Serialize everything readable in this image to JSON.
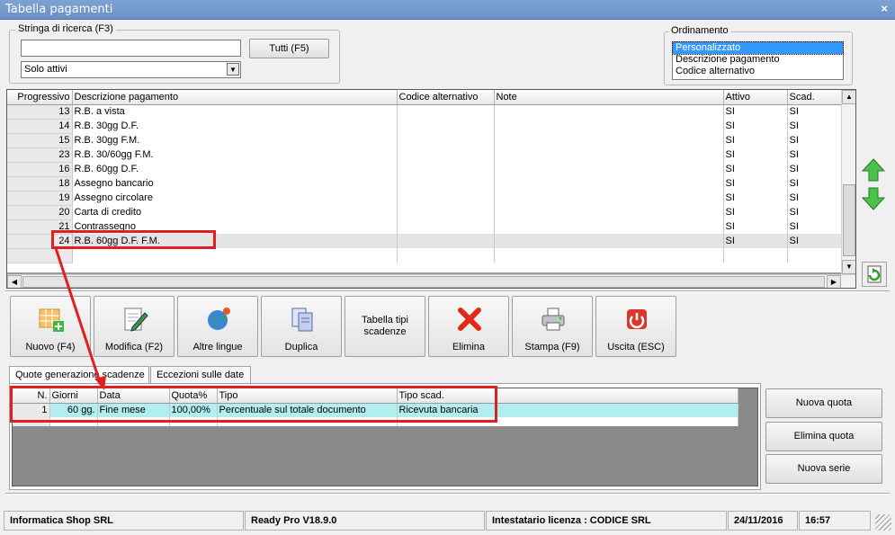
{
  "window": {
    "title": "Tabella pagamenti",
    "close": "×"
  },
  "search": {
    "legend": "Stringa di ricerca (F3)",
    "value": "",
    "all_button": "Tutti (F5)",
    "filter_selected": "Solo attivi"
  },
  "sort": {
    "legend": "Ordinamento",
    "options": [
      "Personalizzato",
      "Descrizione pagamento",
      "Codice alternativo"
    ],
    "selected": "Personalizzato"
  },
  "main_table": {
    "columns": [
      "Progressivo",
      "Descrizione pagamento",
      "Codice alternativo",
      "Note",
      "Attivo",
      "Scad."
    ],
    "rows": [
      {
        "prog": "13",
        "desc": "R.B. a vista",
        "code": "",
        "note": "",
        "active": "SI",
        "scad": "SI"
      },
      {
        "prog": "14",
        "desc": "R.B. 30gg D.F.",
        "code": "",
        "note": "",
        "active": "SI",
        "scad": "SI"
      },
      {
        "prog": "15",
        "desc": "R.B. 30gg F.M.",
        "code": "",
        "note": "",
        "active": "SI",
        "scad": "SI"
      },
      {
        "prog": "23",
        "desc": "R.B. 30/60gg F.M.",
        "code": "",
        "note": "",
        "active": "SI",
        "scad": "SI"
      },
      {
        "prog": "16",
        "desc": "R.B. 60gg D.F.",
        "code": "",
        "note": "",
        "active": "SI",
        "scad": "SI"
      },
      {
        "prog": "18",
        "desc": "Assegno bancario",
        "code": "",
        "note": "",
        "active": "SI",
        "scad": "SI"
      },
      {
        "prog": "19",
        "desc": "Assegno circolare",
        "code": "",
        "note": "",
        "active": "SI",
        "scad": "SI"
      },
      {
        "prog": "20",
        "desc": "Carta di credito",
        "code": "",
        "note": "",
        "active": "SI",
        "scad": "SI"
      },
      {
        "prog": "21",
        "desc": "Contrassegno",
        "code": "",
        "note": "",
        "active": "SI",
        "scad": "SI"
      },
      {
        "prog": "24",
        "desc": "R.B. 60gg D.F. F.M.",
        "code": "",
        "note": "",
        "active": "SI",
        "scad": "SI"
      }
    ]
  },
  "toolbar": {
    "new": "Nuovo (F4)",
    "edit": "Modifica (F2)",
    "languages": "Altre lingue",
    "duplicate": "Duplica",
    "due_types": "Tabella tipi scadenze",
    "delete": "Elimina",
    "print": "Stampa (F9)",
    "exit": "Uscita (ESC)"
  },
  "tabs": [
    "Quote generazione scadenze",
    "Eccezioni sulle date"
  ],
  "quote_table": {
    "columns": [
      "N.",
      "Giorni",
      "Data",
      "Quota%",
      "Tipo",
      "Tipo scad."
    ],
    "rows": [
      {
        "n": "1",
        "days": "60 gg.",
        "date": "Fine mese",
        "quota": "100,00%",
        "type": "Percentuale sul totale documento",
        "due_type": "Ricevuta bancaria"
      }
    ]
  },
  "side_buttons": {
    "new_quota": "Nuova quota",
    "delete_quota": "Elimina quota",
    "new_series": "Nuova serie"
  },
  "status_bar": {
    "company": "Informatica Shop SRL",
    "version": "Ready Pro V18.9.0",
    "license": "Intestatario licenza : CODICE SRL",
    "date": "24/11/2016",
    "time": "16:57"
  },
  "colors": {
    "highlight": "#e02020",
    "selected_row": "#b2eef0",
    "titlebar": "#7fa3d2"
  }
}
